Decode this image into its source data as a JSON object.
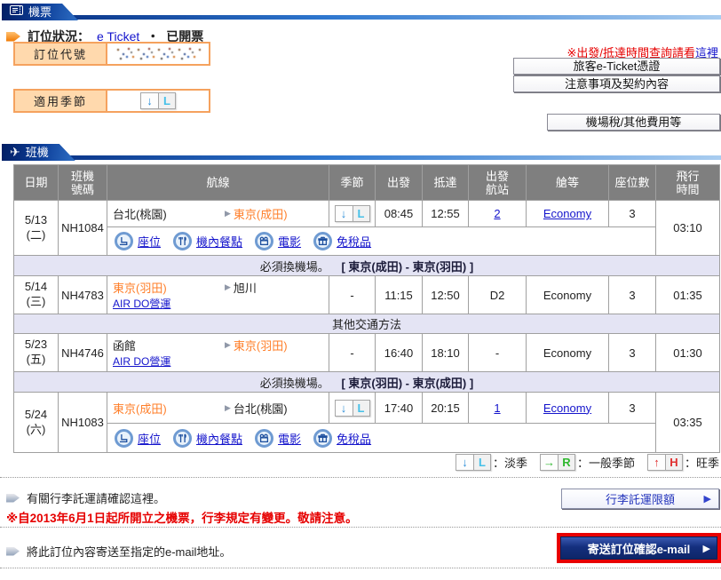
{
  "icons": {
    "plane": "✈",
    "route_arrow": "▶",
    "button_arrow": "▶"
  },
  "ticket": {
    "tab": "機票",
    "status": {
      "label": "訂位狀況：",
      "link": "e Ticket",
      "sep": "・",
      "value": "已開票"
    },
    "booking_code": {
      "label": "訂位代號",
      "value_redacted": true
    },
    "season_box": {
      "label": "適用季節",
      "arrow": "↓",
      "letter": "L"
    },
    "time_note": {
      "text": "※出發/抵達時間查詢請看",
      "link": "這裡"
    },
    "buttons": {
      "eticket": "旅客e-Ticket憑證",
      "notes": "注意事項及契約內容",
      "tax": "機場稅/其他費用等"
    }
  },
  "flights": {
    "tab": "班機",
    "columns": [
      "日期",
      "班機\n號碼",
      "航線",
      "季節",
      "出發",
      "抵達",
      "出發\n航站",
      "艙等",
      "座位數",
      "飛行\n時間"
    ],
    "rows": [
      {
        "date": "5/13\n(二)",
        "no": "NH1084",
        "origin": "台北(桃園)",
        "dest": "東京(成田)",
        "season": "L",
        "season_arrow": "↓",
        "dep": "08:45",
        "arr": "12:55",
        "terminal": "2",
        "cabin": "Economy",
        "seats": "3",
        "duration": "03:10"
      },
      {
        "date": "5/14\n(三)",
        "no": "NH4783",
        "origin": "東京(羽田)",
        "operator": "AIR DO營運",
        "dest": "旭川",
        "season": "-",
        "dep": "11:15",
        "arr": "12:50",
        "terminal": "D2",
        "cabin": "Economy",
        "seats": "3",
        "duration": "01:35"
      },
      {
        "date": "5/23\n(五)",
        "no": "NH4746",
        "origin": "函館",
        "operator": "AIR DO營運",
        "dest": "東京(羽田)",
        "season": "-",
        "dep": "16:40",
        "arr": "18:10",
        "terminal": "-",
        "cabin": "Economy",
        "seats": "3",
        "duration": "01:30"
      },
      {
        "date": "5/24\n(六)",
        "no": "NH1083",
        "origin": "東京(成田)",
        "dest": "台北(桃園)",
        "season": "L",
        "season_arrow": "↓",
        "dep": "17:40",
        "arr": "20:15",
        "terminal": "1",
        "cabin": "Economy",
        "seats": "3",
        "duration": "03:35"
      }
    ],
    "services": [
      "座位",
      "機內餐點",
      "電影",
      "免稅品"
    ],
    "notes": {
      "transfer1": {
        "text": "必須換機場。",
        "route": "[ 東京(成田) - 東京(羽田) ]"
      },
      "other": "其他交通方法",
      "transfer2": {
        "text": "必須換機場。",
        "route": "[ 東京(羽田) - 東京(成田) ]"
      }
    },
    "legend": [
      {
        "arrow": "↓",
        "letter": "L",
        "label": "：淡季"
      },
      {
        "arrow": "→",
        "letter": "R",
        "label": "：一般季節"
      },
      {
        "arrow": "↑",
        "letter": "H",
        "label": "：旺季"
      }
    ]
  },
  "footer": {
    "baggage": {
      "text": "有關行李託運請確認這裡。",
      "button": "行李託運限額"
    },
    "warning": "※自2013年6月1日起所開立之機票，行李規定有變更。敬請注意。",
    "email": {
      "text": "將此訂位內容寄送至指定的e-mail地址。",
      "button": "寄送訂位確認e-mail"
    }
  },
  "colors": {
    "accent_orange_border": "#f5a25e",
    "peach_bg": "#ffd9ad",
    "tab_navy": "#0d3f9a",
    "link_blue": "#1414cc",
    "city_orange": "#ff7f2a",
    "table_header_gray": "#7f7f7f",
    "lavender_row": "#e4e4f4",
    "highlight_red": "#e80000",
    "warning_red": "#e60000",
    "season_l_letter": "#45c0e8",
    "season_arrow_blue": "#2f8fd8",
    "season_r_green": "#2eb82e",
    "season_h_red": "#e03030"
  }
}
